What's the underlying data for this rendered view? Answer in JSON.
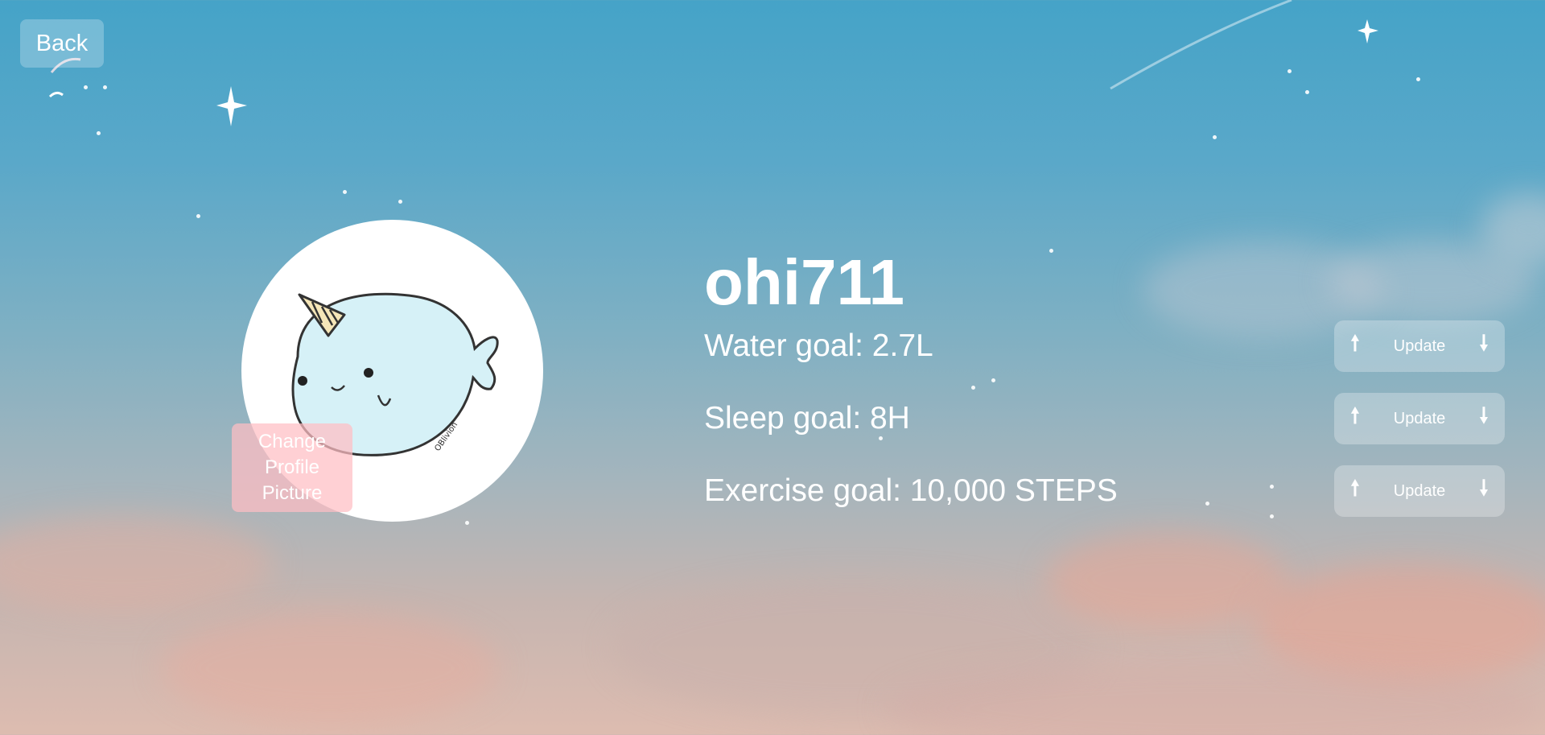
{
  "nav": {
    "back_label": "Back"
  },
  "profile": {
    "username": "ohi711",
    "change_picture_label": "Change Profile Picture",
    "avatar_icon": "narwhal-avatar-icon",
    "avatar_signature": "OBlivion"
  },
  "goals": [
    {
      "label": "Water goal: 2.7L",
      "update_label": "Update"
    },
    {
      "label": "Sleep goal: 8H",
      "update_label": "Update"
    },
    {
      "label": "Exercise goal: 10,000 STEPS",
      "update_label": "Update"
    }
  ],
  "icons": {
    "increase": "arrow-up-icon",
    "decrease": "arrow-down-icon"
  },
  "colors": {
    "sky_top": "#45a3c8",
    "sky_bottom": "#ddbcb0",
    "text": "#ffffff",
    "narwhal_body": "#d6f1f7",
    "change_pic_bg": "#ffbec4"
  }
}
